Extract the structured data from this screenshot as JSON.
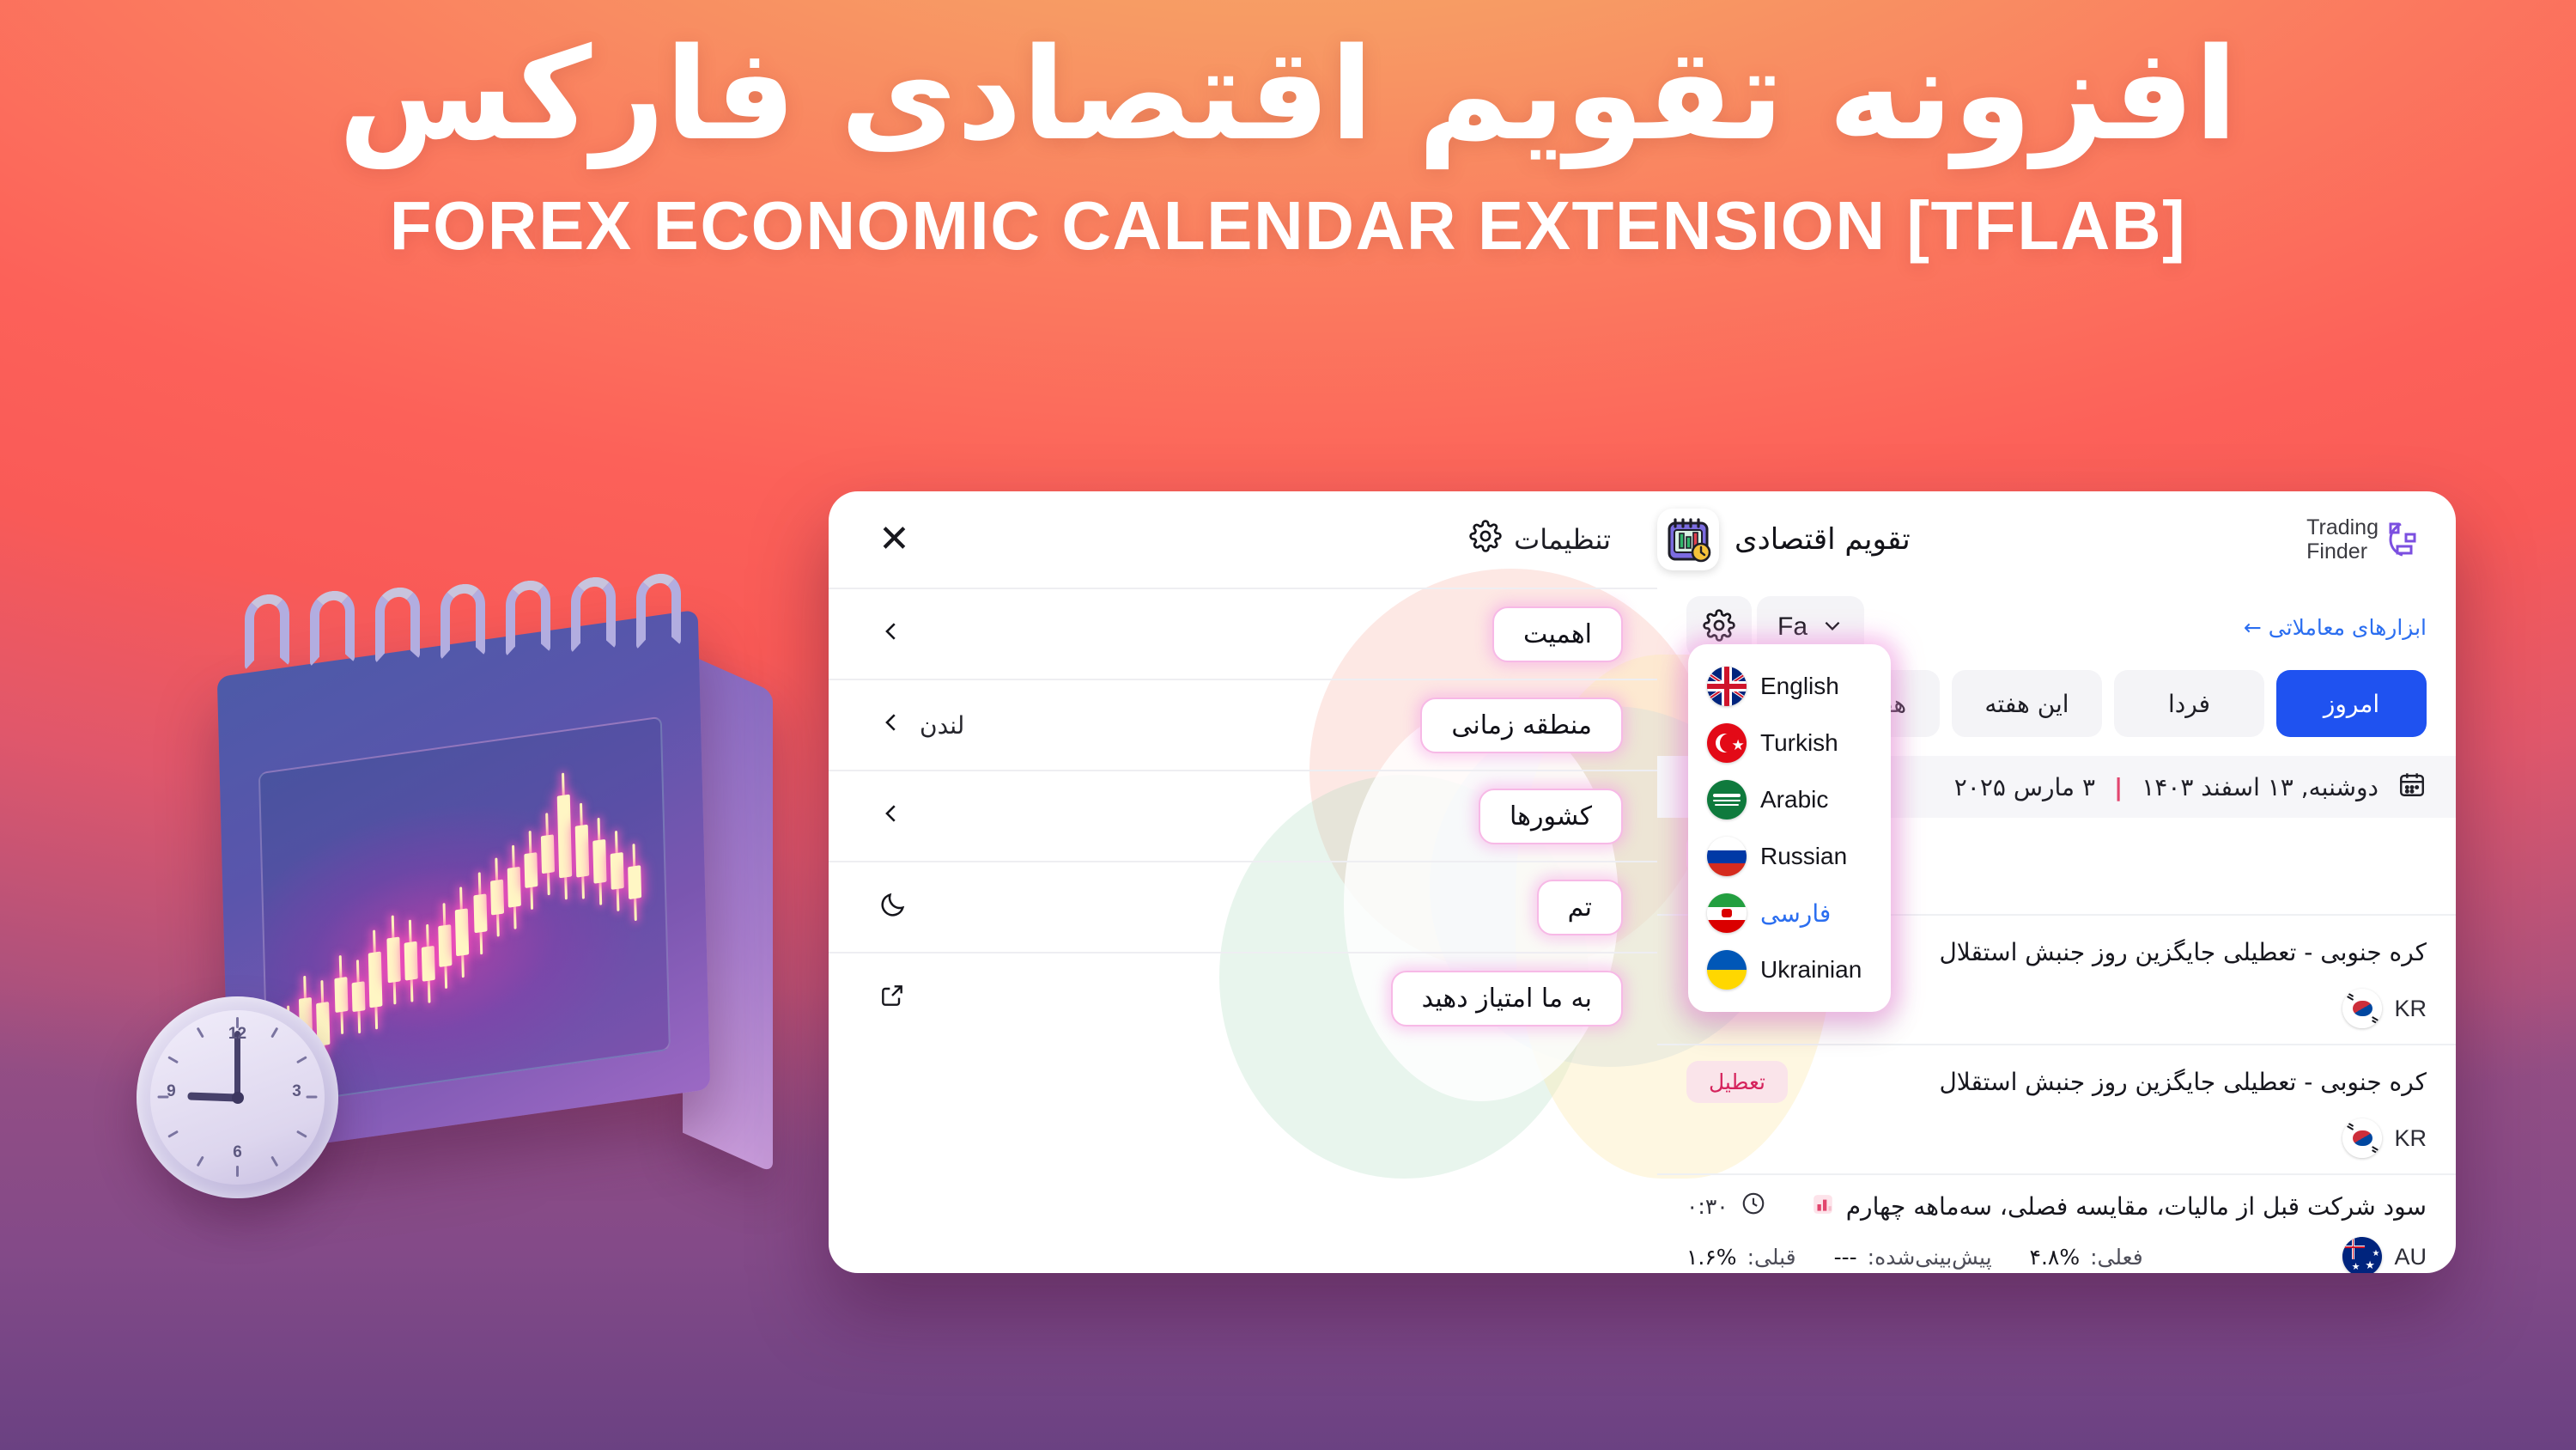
{
  "hero": {
    "title_fa": "افزونه تقویم اقتصادی فارکس",
    "title_en": "FOREX ECONOMIC CALENDAR EXTENSION [TFLAB]"
  },
  "colors": {
    "accent_blue": "#1f52f0",
    "link_blue": "#2b6ef0",
    "pill_border": "#f7b9e6",
    "holiday_bg": "#fae4ea",
    "holiday_text": "#d5235c",
    "bg_top": "#f7b06a",
    "bg_mid": "#fc6159",
    "bg_bottom": "#6e4a8e"
  },
  "settings": {
    "title": "تنظیمات",
    "close_label": "✕",
    "rows": [
      {
        "label": "اهمیت",
        "value": "",
        "icon": "chevron-left-icon"
      },
      {
        "label": "منطقه زمانی",
        "value": "لندن",
        "icon": "chevron-left-icon"
      },
      {
        "label": "کشورها",
        "value": "",
        "icon": "chevron-left-icon"
      },
      {
        "label": "تم",
        "value": "",
        "icon": "moon-icon"
      },
      {
        "label": "به ما امتیاز دهید",
        "value": "",
        "icon": "external-link-icon"
      }
    ]
  },
  "calendar": {
    "brand_title": "تقویم اقتصادی",
    "logo_line1": "Trading",
    "logo_line2": "Finder",
    "tools_link": "ابزارهای معاملاتی ←",
    "lang_button": "Fa",
    "tabs": [
      {
        "label": "امروز",
        "active": true
      },
      {
        "label": "فردا",
        "active": false
      },
      {
        "label": "این هفته",
        "active": false
      },
      {
        "label": "هفته بعد",
        "active": false
      }
    ],
    "date_jalali": "دوشنبه, ۱۳ اسفند ۱۴۰۳",
    "date_sep": "|",
    "date_gregorian": "۳ مارس ۲۰۲۵",
    "labels": {
      "actual": "فعلی:",
      "forecast": "پیش‌بینی‌شده:",
      "previous": "قبلی:"
    },
    "events": [
      {
        "title": "",
        "time": "",
        "badge": "تعطیل",
        "country_code": "",
        "flag": "none",
        "actual": "",
        "forecast": "",
        "previous": "",
        "has_stats": false
      },
      {
        "title": "کره جنوبی - تعطیلی جایگزین روز جنبش استقلال",
        "time": "",
        "badge": "تعطیل",
        "country_code": "KR",
        "flag": "kr",
        "actual": "",
        "forecast": "",
        "previous": "",
        "has_stats": false
      },
      {
        "title": "کره جنوبی - تعطیلی جایگزین روز جنبش استقلال",
        "time": "",
        "badge": "تعطیل",
        "country_code": "KR",
        "flag": "kr",
        "actual": "",
        "forecast": "",
        "previous": "",
        "has_stats": false
      },
      {
        "title": "سود شرکت قبل از مالیات، مقایسه فصلی، سه‌ماهه چهارم",
        "time": "۰:۳۰",
        "badge": "",
        "country_code": "AU",
        "flag": "au",
        "actual": "۴.۸%",
        "forecast": "---",
        "previous": "۱.۶%",
        "has_stats": true
      }
    ],
    "language_menu": [
      {
        "name": "English",
        "flag": "gb",
        "selected": false
      },
      {
        "name": "Turkish",
        "flag": "tr",
        "selected": false
      },
      {
        "name": "Arabic",
        "flag": "sa",
        "selected": false
      },
      {
        "name": "Russian",
        "flag": "ru",
        "selected": false
      },
      {
        "name": "فارسی",
        "flag": "ir",
        "selected": true
      },
      {
        "name": "Ukrainian",
        "flag": "ua",
        "selected": false
      }
    ]
  }
}
